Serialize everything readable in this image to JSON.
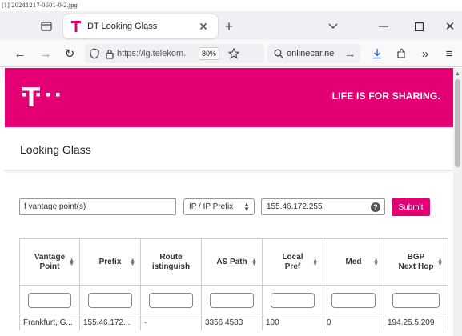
{
  "caption": "[1] 20241217-0601-0-2.jpg",
  "browser": {
    "tab": {
      "title": "DT Looking Glass"
    },
    "url_text": "https://lg.telekom.",
    "zoom": "80%",
    "search_text": "onlinecar.ne"
  },
  "page": {
    "slogan": "LIFE IS FOR SHARING.",
    "title": "Looking Glass",
    "controls": {
      "vantage_placeholder": "f vantage point(s)",
      "select_value": "IP / IP Prefix",
      "ip_value": "155.46.172.255",
      "help": "?",
      "submit": "Submit"
    },
    "table": {
      "headers": [
        "Vantage\nPoint",
        "Prefix",
        "Route\nistinguish",
        "AS Path",
        "Local\nPref",
        "Med",
        "BGP\nNext Hop"
      ],
      "rows": [
        [
          "Frankfurt, G...",
          "155.46.172...",
          "-",
          "3356 4583",
          "100",
          "0",
          "194.25.5.209"
        ]
      ]
    }
  },
  "colors": {
    "brand": "#e20074"
  }
}
